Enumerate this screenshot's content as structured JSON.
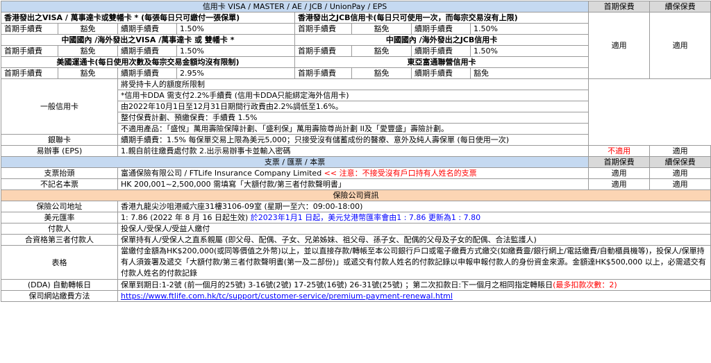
{
  "header": {
    "methods": "信用卡 VISA / MASTER / AE / JCB / UnionPay / EPS",
    "initial": "首期保費",
    "renewal": "續保保費"
  },
  "hk_visa": {
    "title": "香港發出之VISA / 萬事達卡或雙幡卡 * (每張每日只可繳付一張保單)",
    "k1": "首期手續費",
    "v1": "豁免",
    "k2": "續期手續費",
    "v2": "1.50%"
  },
  "hk_jcb": {
    "title": "香港發出之JCB信用卡(每日只可使用一次，而每宗交易沒有上限)",
    "k1": "首期手續費",
    "v1": "豁免",
    "k2": "續期手續費",
    "v2": "1.50%"
  },
  "cn_visa": {
    "title": "中國國內 /海外發出之VISA /萬事達卡 或 雙幡卡 *",
    "k1": "首期手續費",
    "v1": "豁免",
    "k2": "續期手續費",
    "v2": "1.50%"
  },
  "cn_jcb": {
    "title": "中國國內 /海外發出之JCB信用卡",
    "k1": "首期手續費",
    "v1": "豁免",
    "k2": "續期手續費",
    "v2": "1.50%"
  },
  "ae": {
    "title": "美國運通卡(每日使用次數及每宗交易金額均沒有限制)",
    "k1": "首期手續費",
    "v1": "豁免",
    "k2": "續期手續費",
    "v2": "2.95%"
  },
  "bea": {
    "title": "東亞富通聯營信用卡",
    "k1": "首期手續費",
    "v1": "豁免",
    "k2": "續期手續費",
    "v2": "豁免"
  },
  "cards_applicable": {
    "initial": "適用",
    "renewal": "適用"
  },
  "general": {
    "label": "一般信用卡",
    "l1": "將受持卡人的額度所限制",
    "l2": "*信用卡DDA 需支付2.2%手續費 (信用卡DDA只能綁定海外信用卡)",
    "l3": "由2022年10月1日至12月31日期間行政費由2.2%調低至1.6%。",
    "l4": "整付保費計劃、預繳保費：手續費 1.5%",
    "l5": "不適用產品：「盛悅」萬用壽險保障計劃、「盛利保」萬用壽險尊尚計劃 II及「愛豐盛」壽險計劃。"
  },
  "unionpay": {
    "label": "銀聯卡",
    "text": "續期手續費：1.5% 每保單交易上限為美元5,000；只接受沒有儲蓄成份的醫療、意外及純人壽保單 (每日使用一次)"
  },
  "eps": {
    "label": "易辦事 (EPS)",
    "text": "1.親自前往繳費處付款   2.出示易辦事卡並輸入密碼",
    "initial": "不適用",
    "renewal": "適用"
  },
  "cheque_header": {
    "title": "支票 / 匯票 / 本票",
    "initial": "首期保費",
    "renewal": "續保保費"
  },
  "cheque_payee": {
    "label": "支票抬頭",
    "text": "富通保險有限公司 / FTLife Insurance Company Limited",
    "note": "  << 注意：不接受沒有戶口持有人姓名的支票",
    "initial": "適用",
    "renewal": "適用"
  },
  "bearer": {
    "label": "不記名本票",
    "text": "HK 200,001~2,500,000   需填寫「大額付款/第三者付款聲明書」",
    "initial": "適用",
    "renewal": "適用"
  },
  "info_header": "保險公司資訊",
  "address": {
    "label": "保險公司地址",
    "text": "香港九龍尖沙咀港威六座31樓3106-09室 (星期一至六：09:00-18:00)"
  },
  "fx": {
    "label": "美元匯率",
    "text": "1: 7.86  (2022 年 8 月 16 日起生效)",
    "note": "  於2023年1月1 日起，美元兌港幣匯率會由1 : 7.86 更新為1 : 7.80"
  },
  "payer": {
    "label": "付款人",
    "text": "投保人/受保人/受益人繳付"
  },
  "third_party": {
    "label": "合資格第三者付款人",
    "text": "保單持有人/受保人之直系親屬 (即父母、配偶、子女、兄弟姊妹、祖父母、孫子女、配偶的父母及子女的配偶、合法監護人)"
  },
  "form": {
    "label": "表格",
    "text": "當繳付金額為HK$200,000(或同等價值之外幣)以上，並以直接存款/轉帳至本公司銀行戶口或電子繳費方式繳交(如繳費靈/銀行網上/電話繳費/自動櫃員機等)，投保人/保單持有人須簽署及遞交「大額付款/第三者付款聲明書(第一及二部份)」或遞交有付款人姓名的付款記錄以申報申報付款人的身份資金來源。金額達HK$500,000 以上，必需遞交有付款人姓名的付款記錄"
  },
  "dda": {
    "label": "(DDA) 自動轉帳日",
    "text": "保單到期日:1-2號 (前一個月的25號) 3-16號(2號) 17-25號(16號) 26-31號(25號) ；第二次扣款日:下一個月之相同指定轉賬日",
    "note": "(最多扣款次數：2)"
  },
  "web": {
    "label": "保司網站繳費方法",
    "url": "https://www.ftlife.com.hk/tc/support/customer-service/premium-payment-renewal.html"
  },
  "colors": {
    "blue_header": "#c5d9f1",
    "tan_header": "#fcd5b4",
    "gray_header": "#d9d9d9",
    "alert": "#ff0000",
    "link": "#0000ff"
  }
}
